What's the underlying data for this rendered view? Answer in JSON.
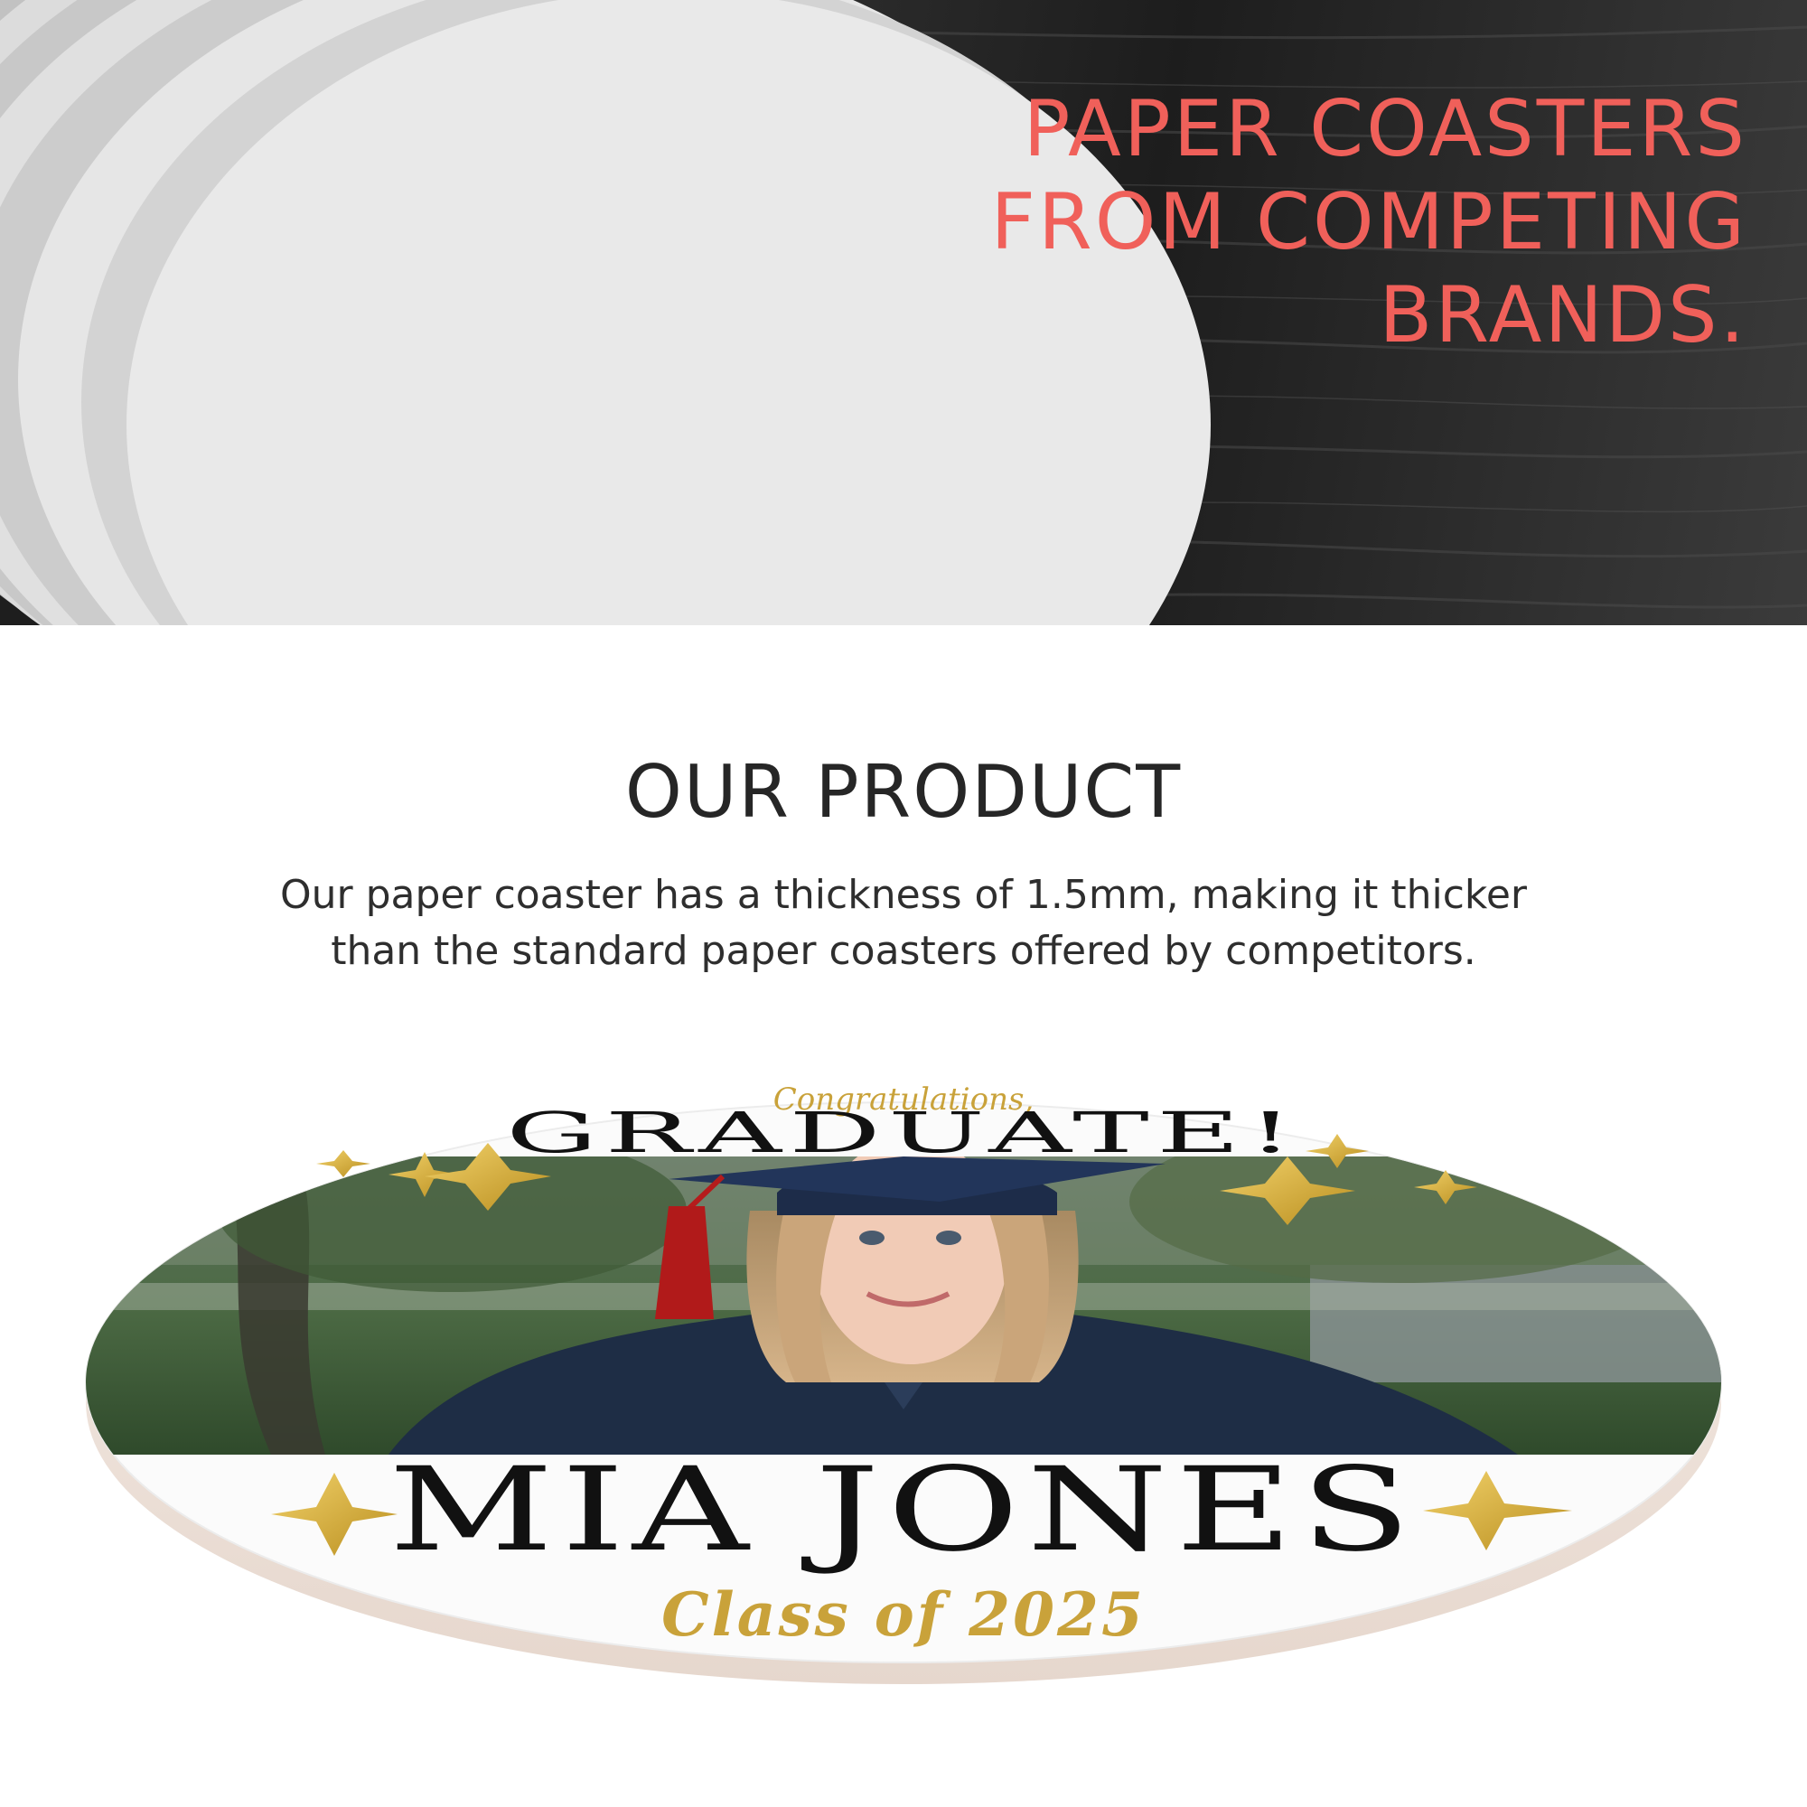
{
  "hero": {
    "title_lines": [
      "PAPER COASTERS",
      "FROM COMPETING",
      "BRANDS."
    ],
    "title_color": "#f0605a"
  },
  "product": {
    "title": "OUR PRODUCT",
    "description_lines": [
      "Our paper coaster has a thickness of 1.5mm, making it thicker",
      "than the standard paper coasters offered by competitors."
    ]
  },
  "coaster": {
    "top_script": "Congratulations,",
    "headline": "GRADUATE!",
    "name": "MIA JONES",
    "class_line": "Class of 2025",
    "accent_color": "#c9a23a"
  }
}
